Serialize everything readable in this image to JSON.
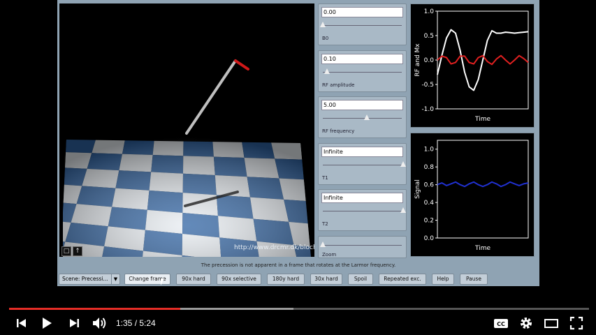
{
  "controls": [
    {
      "value": "0.00",
      "label": "B0",
      "slider_fraction": 0.0
    },
    {
      "value": "0.10",
      "label": "RF amplitude",
      "slider_fraction": 0.05
    },
    {
      "value": "5.00",
      "label": "RF frequency",
      "slider_fraction": 0.55
    },
    {
      "value": "Infinite",
      "label": "T1",
      "slider_fraction": 1.0
    },
    {
      "value": "Infinite",
      "label": "T2",
      "slider_fraction": 1.0
    },
    {
      "value": "",
      "label": "Zoom",
      "slider_fraction": 0.0
    }
  ],
  "viewport": {
    "url": "http://www.drcmr.dk/bloch",
    "icons": [
      "lock-icon",
      "arrow-up-icon"
    ]
  },
  "caption": "The precession is not apparent in a frame that rotates at the Larmor frequency.",
  "scene_select": {
    "value": "Scene: Precessi..."
  },
  "buttons": [
    {
      "label": "Change frame",
      "name": "change-frame-button"
    },
    {
      "label": "90x hard",
      "name": "90x-hard-button"
    },
    {
      "label": "90x selective",
      "name": "90x-selective-button"
    },
    {
      "label": "180y hard",
      "name": "180y-hard-button"
    },
    {
      "label": "30x hard",
      "name": "30x-hard-button"
    },
    {
      "label": "Spoil",
      "name": "spoil-button"
    },
    {
      "label": "Repeated exc.",
      "name": "repeated-exc-button"
    },
    {
      "label": "Help",
      "name": "help-button"
    },
    {
      "label": "Pause",
      "name": "pause-button"
    }
  ],
  "chart_data": [
    {
      "type": "line",
      "ylabel": "RF and Mx",
      "xlabel": "Time",
      "ylim": [
        -1.0,
        1.0
      ],
      "yticks": [
        "1.0",
        "0.5",
        "0.0",
        "-0.5",
        "-1.0"
      ],
      "series": [
        {
          "color": "#ffffff",
          "x": [
            0,
            0.05,
            0.1,
            0.15,
            0.2,
            0.25,
            0.3,
            0.35,
            0.4,
            0.45,
            0.5,
            0.55,
            0.6,
            0.65,
            0.7,
            0.75,
            0.8,
            0.85,
            0.9,
            0.95,
            1.0
          ],
          "y": [
            -0.3,
            0.1,
            0.45,
            0.62,
            0.55,
            0.2,
            -0.25,
            -0.55,
            -0.62,
            -0.4,
            0.0,
            0.4,
            0.6,
            0.55,
            0.55,
            0.57,
            0.56,
            0.55,
            0.56,
            0.57,
            0.58
          ]
        },
        {
          "color": "#e02020",
          "x": [
            0,
            0.05,
            0.1,
            0.15,
            0.2,
            0.25,
            0.3,
            0.35,
            0.4,
            0.45,
            0.5,
            0.55,
            0.6,
            0.65,
            0.7,
            0.75,
            0.8,
            0.85,
            0.9,
            0.95,
            1.0
          ],
          "y": [
            0.0,
            0.08,
            0.05,
            -0.08,
            -0.05,
            0.08,
            0.08,
            -0.05,
            -0.08,
            0.05,
            0.09,
            -0.03,
            -0.09,
            0.02,
            0.09,
            0.0,
            -0.08,
            0.0,
            0.09,
            0.03,
            -0.05
          ]
        }
      ]
    },
    {
      "type": "line",
      "ylabel": "Signal",
      "xlabel": "Time",
      "ylim": [
        0.0,
        1.1
      ],
      "yticks": [
        "1.0",
        "0.8",
        "0.6",
        "0.4",
        "0.2",
        "0.0"
      ],
      "series": [
        {
          "color": "#2030d0",
          "x": [
            0,
            0.05,
            0.1,
            0.15,
            0.2,
            0.25,
            0.3,
            0.35,
            0.4,
            0.45,
            0.5,
            0.55,
            0.6,
            0.65,
            0.7,
            0.75,
            0.8,
            0.85,
            0.9,
            0.95,
            1.0
          ],
          "y": [
            0.6,
            0.62,
            0.59,
            0.61,
            0.63,
            0.6,
            0.58,
            0.61,
            0.63,
            0.6,
            0.58,
            0.6,
            0.63,
            0.61,
            0.58,
            0.6,
            0.63,
            0.61,
            0.59,
            0.61,
            0.62
          ]
        }
      ]
    }
  ],
  "player": {
    "current_time": "1:35",
    "duration": "5:24",
    "time_display": "1:35 / 5:24",
    "played_fraction": 0.295,
    "buffered_fraction": 0.49
  }
}
